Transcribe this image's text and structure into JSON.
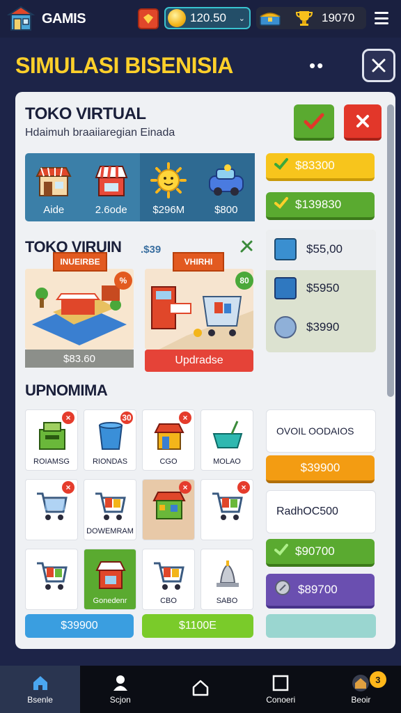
{
  "header": {
    "app_name": "GAMIS",
    "currency_value": "120.50",
    "currency_dropdown": "⌄",
    "wallet_value": "19070"
  },
  "page": {
    "title": "SIMULASI BISENISIA",
    "more_label": "••"
  },
  "store": {
    "title": "TOKO VIRTUAL",
    "subtitle": "Hdaimuh braaiiaregian Einada",
    "stats": [
      {
        "icon": "storefront-icon",
        "value": "Aide"
      },
      {
        "icon": "market-stall-icon",
        "value": "2.6ode"
      },
      {
        "icon": "sun-icon",
        "value": "$296M"
      },
      {
        "icon": "delivery-car-icon",
        "value": "$800"
      }
    ]
  },
  "right_buttons": {
    "btn1": "$83300",
    "btn2": "$139830",
    "price_rows": [
      "$55,00",
      "$5950",
      "$3990"
    ]
  },
  "section2": {
    "title": "TOKO VIRUIN",
    "price_label": ".$39",
    "shop1_banner": "INUEIRBE",
    "shop1_badge": "%",
    "shop1_price": "$83.60",
    "shop2_banner": "VHIRHI",
    "shop2_badge": "80",
    "upgrade_label": "Updradse"
  },
  "section3": {
    "title": "UPNOMIMA",
    "tiles": [
      {
        "label": "ROIAMSG",
        "badge": "×"
      },
      {
        "label": "RIONDAS",
        "badge": "30"
      },
      {
        "label": "CGO",
        "badge": "×"
      },
      {
        "label": "MOLAO",
        "badge": ""
      },
      {
        "label": "",
        "badge": "×"
      },
      {
        "label": "DOWEMRAM",
        "badge": ""
      },
      {
        "label": "",
        "badge": "×"
      },
      {
        "label": "",
        "badge": "×"
      },
      {
        "label": "",
        "badge": ""
      },
      {
        "label": "Gonedenr",
        "badge": ""
      },
      {
        "label": "CBO",
        "badge": ""
      },
      {
        "label": "SABO",
        "badge": ""
      }
    ],
    "bar1": "$39900",
    "bar2": "$1100E",
    "info1": "OVOIL OODAIOS",
    "price_btn1": "$39900",
    "info2": "RadhOC500",
    "price_btn2": "$90700",
    "price_btn3": "$89700"
  },
  "nav": [
    {
      "label": "Bsenle"
    },
    {
      "label": "Scjon"
    },
    {
      "label": ""
    },
    {
      "label": "Conoeri"
    },
    {
      "label": "Beoir",
      "badge": "3"
    }
  ],
  "colors": {
    "accent_yellow": "#ffd02a",
    "green": "#5aaa30",
    "red": "#e2372a",
    "blue": "#3b7fa8",
    "purple": "#6a4fb0",
    "orange": "#f39c12"
  }
}
